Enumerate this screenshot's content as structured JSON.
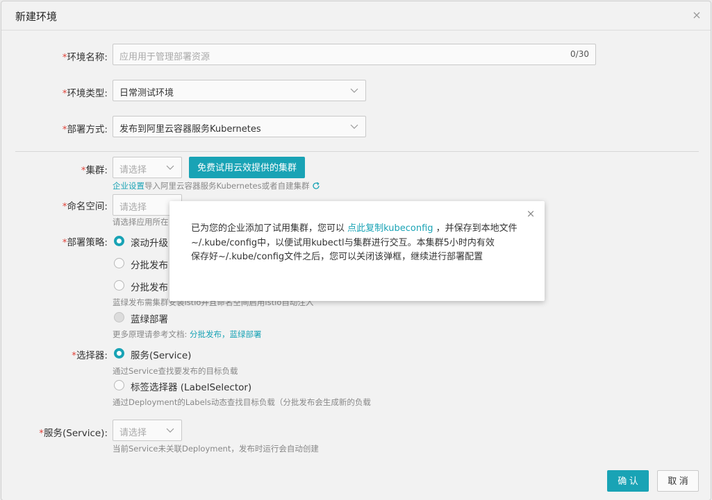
{
  "dialog": {
    "title": "新建环境",
    "close_glyph": "×"
  },
  "form": {
    "env_name": {
      "label": "环境名称:",
      "placeholder": "应用用于管理部署资源",
      "count": "0/30"
    },
    "env_type": {
      "label": "环境类型:",
      "value": "日常测试环境"
    },
    "deploy_method": {
      "label": "部署方式:",
      "value": "发布到阿里云容器服务Kubernetes"
    },
    "cluster": {
      "label": "集群:",
      "placeholder": "请选择",
      "trial_button": "免费试用云效提供的集群",
      "hint_link": "企业设置",
      "hint_text": "导入阿里云容器服务Kubernetes或者自建集群"
    },
    "namespace": {
      "label": "命名空间:",
      "placeholder": "请选择",
      "hint": "请选择应用所在"
    },
    "strategy": {
      "label": "部署策略:",
      "options": [
        {
          "label": "滚动升级",
          "state": "checked"
        },
        {
          "label": "分批发布",
          "state": "unchecked"
        },
        {
          "label": "分批发布",
          "state": "unchecked"
        },
        {
          "label": "蓝绿部署",
          "state": "disabled"
        }
      ],
      "bluegreen_hint": "蓝绿发布需集群安装istio并且命名空间启用istio自动注入",
      "more_hint": "更多原理请参考文档:",
      "more_links": "分批发布，蓝绿部署"
    },
    "selector": {
      "label": "选择器:",
      "options": [
        {
          "label": "服务(Service)",
          "state": "checked"
        },
        {
          "label": "标签选择器 (LabelSelector)",
          "state": "unchecked"
        }
      ],
      "service_hint": "通过Service查找要发布的目标负载",
      "label_hint": "通过Deployment的Labels动态查找目标负载（分批发布会生成新的负载"
    },
    "service": {
      "label": "服务(Service):",
      "placeholder": "请选择",
      "hint": "当前Service未关联Deployment，发布时运行会自动创建"
    },
    "required_mark": "*"
  },
  "footer": {
    "confirm": "确 认",
    "cancel": "取 消"
  },
  "popup": {
    "close_glyph": "×",
    "text_before": "已为您的企业添加了试用集群，您可以 ",
    "link": "点此复制kubeconfig",
    "text_after": " ，并保存到本地文件~/.kube/config中，以便试用kubectl与集群进行交互。本集群5小时内有效",
    "line2": "保存好~/.kube/config文件之后，您可以关闭该弹框，继续进行部署配置"
  },
  "colors": {
    "accent": "#19a3b5",
    "required": "#e0453c"
  }
}
